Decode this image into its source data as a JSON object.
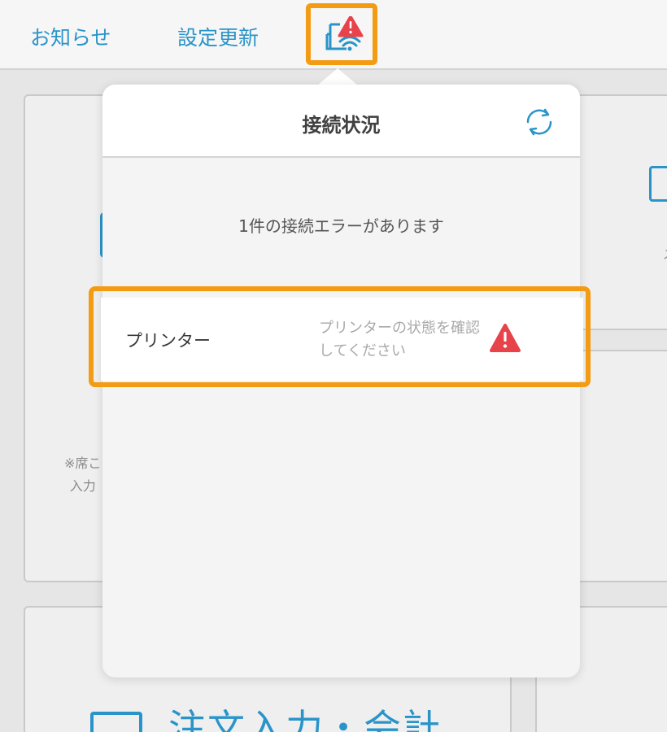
{
  "topbar": {
    "notice_label": "お知らせ",
    "settings_update_label": "設定更新",
    "status_icon": "printer-wifi-alert-icon"
  },
  "background": {
    "note_text": "※席こ\n入力",
    "fragment_x": "メ",
    "order_label": "注文入力・会計"
  },
  "popover": {
    "title": "接続状況",
    "refresh_icon": "refresh-icon",
    "error_summary": "1件の接続エラーがあります",
    "devices": [
      {
        "name": "プリンター",
        "message": "プリンターの状態を確認してください",
        "status_icon": "warning-icon"
      }
    ]
  },
  "colors": {
    "accent_blue": "#2a94c9",
    "highlight_orange": "#f49b14",
    "alert_red": "#e8434a"
  }
}
